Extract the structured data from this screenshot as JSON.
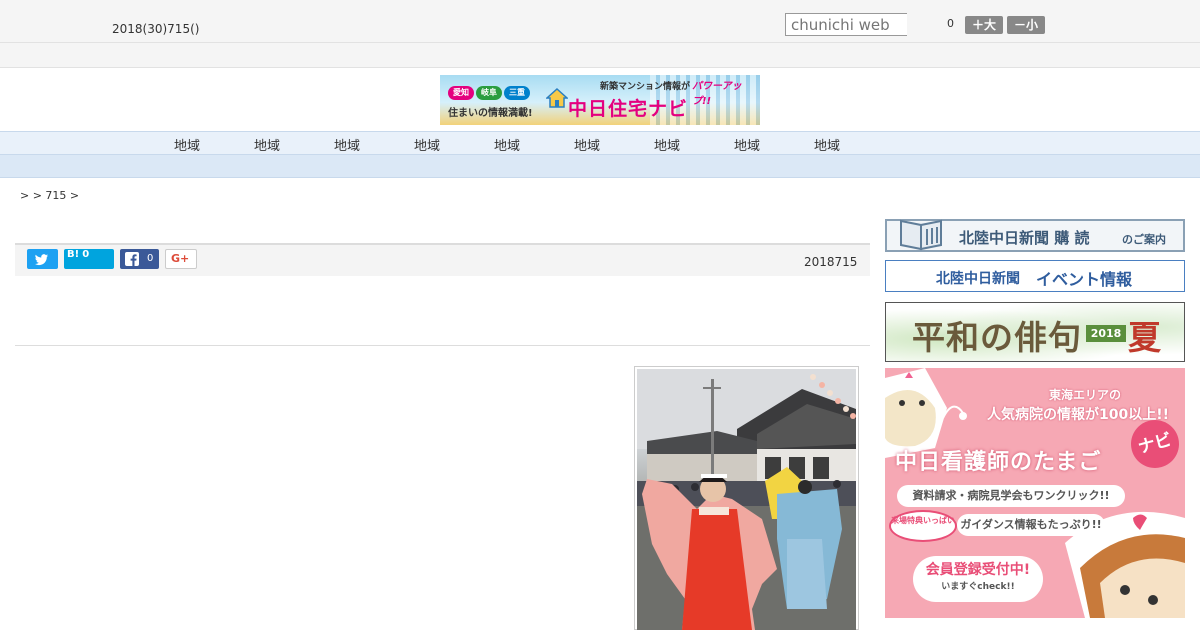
{
  "header": {
    "date": "2018(30)715()",
    "search_placeholder": "chunichi web",
    "font_size_value": "0",
    "font_large_label": "＋大",
    "font_small_label": "－小"
  },
  "banner": {
    "pref1": "愛知",
    "pref2": "岐阜",
    "pref3": "三重",
    "subtitle": "住まいの情報満載!",
    "top_text": "新築マンション情報が",
    "power_text": "パワーアップ!!",
    "logo": "中日住宅ナビ"
  },
  "nav": {
    "items": [
      "地域",
      "地域",
      "地域",
      "地域",
      "地域",
      "地域",
      "地域",
      "地域",
      "地域"
    ]
  },
  "breadcrumb": ">  > 715 >",
  "share": {
    "hatena_label": "B!",
    "hatena_count": "0",
    "facebook_count": "0",
    "gplus_label": "G+"
  },
  "article": {
    "date": "2018715"
  },
  "sidebar": {
    "subscribe_title": "北陸中日新聞 購 読",
    "subscribe_suffix": "のご案内",
    "event_name": "北陸中日新聞",
    "event_label": "イベント情報",
    "haiku_title": "平和の俳句",
    "haiku_year": "2018",
    "haiku_season": "夏",
    "ad": {
      "line1": "東海エリアの",
      "line2": "人気病院の情報が100以上!!",
      "title": "中日看護師のたまご",
      "navi": "ナビ",
      "pill1": "資料請求・病院見学会もワンクリック!!",
      "badge": "来場特典いっぱい",
      "pill2": "ガイダンス情報もたっぷり!!",
      "cta": "会員登録受付中!",
      "cta_sub": "いますぐcheck!!"
    }
  },
  "colors": {
    "nav_bg": "#e9f1fa",
    "twitter": "#1da1f2",
    "hatena": "#00a4de",
    "facebook": "#3b5998",
    "ad_pink": "#f6a8b4"
  }
}
